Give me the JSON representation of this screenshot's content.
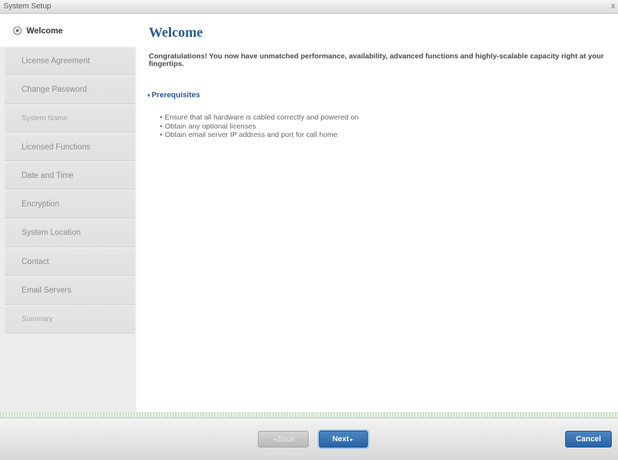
{
  "window": {
    "title": "System Setup",
    "close_glyph": "x"
  },
  "sidebar": {
    "active": {
      "label": "Welcome",
      "icon": "radio-selected-icon"
    },
    "items": [
      {
        "label": "License Agreement"
      },
      {
        "label": "Change Password"
      },
      {
        "label": "System Name"
      },
      {
        "label": "Licensed Functions"
      },
      {
        "label": "Date and Time"
      },
      {
        "label": "Encryption"
      },
      {
        "label": "System Location"
      },
      {
        "label": "Contact"
      },
      {
        "label": "Email Servers"
      },
      {
        "label": "Summary"
      }
    ]
  },
  "main": {
    "heading": "Welcome",
    "intro": "Congratulations! You now have unmatched performance, availability, advanced functions and highly-scalable capacity right at your fingertips.",
    "section": {
      "title": "Prerequisites",
      "toggle_glyph": "▾"
    },
    "prerequisites": [
      "Ensure that all hardware is cabled correctly and powered on",
      "Obtain any optional licenses",
      "Obtain email server IP address and port for call home"
    ]
  },
  "footer": {
    "back_label": "Back",
    "back_arrow": "◂",
    "next_label": "Next",
    "next_arrow": "▸",
    "cancel_label": "Cancel"
  },
  "colors": {
    "accent": "#2b5b8e",
    "button_blue": "#2763a5"
  }
}
